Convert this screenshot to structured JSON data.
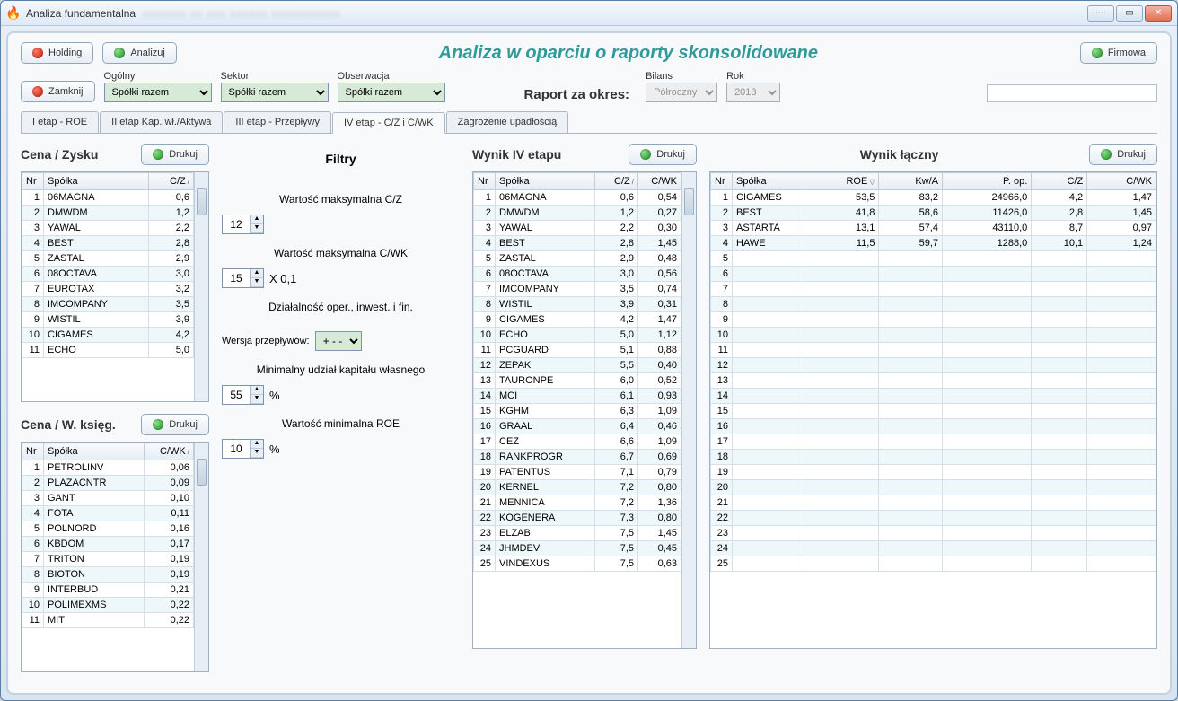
{
  "window": {
    "title": "Analiza fundamentalna"
  },
  "buttons": {
    "holding": "Holding",
    "analizuj": "Analizuj",
    "firmowa": "Firmowa",
    "zamknij": "Zamknij",
    "drukuj": "Drukuj"
  },
  "main_title": "Analiza w oparciu o raporty skonsolidowane",
  "filters_top": {
    "ogolny": {
      "label": "Ogólny",
      "value": "Spółki razem"
    },
    "sektor": {
      "label": "Sektor",
      "value": "Spółki razem"
    },
    "obserwacja": {
      "label": "Obserwacja",
      "value": "Spółki razem"
    },
    "raport_label": "Raport za okres:",
    "bilans": {
      "label": "Bilans",
      "value": "Półroczny"
    },
    "rok": {
      "label": "Rok",
      "value": "2013"
    }
  },
  "tabs": [
    "I etap - ROE",
    "II etap Kap. wł./Aktywa",
    "III etap - Przepływy",
    "IV etap - C/Z i C/WK",
    "Zagrożenie upadłością"
  ],
  "active_tab": 3,
  "section_titles": {
    "cz": "Cena / Zysku",
    "cwk": "Cena / W. księg.",
    "wynik4": "Wynik IV etapu",
    "wynikL": "Wynik łączny",
    "filtry": "Filtry"
  },
  "cols": {
    "nr": "Nr",
    "spolka": "Spółka",
    "cz": "C/Z",
    "cwk": "C/WK",
    "roe": "ROE",
    "kwa": "Kw/A",
    "pop": "P. op."
  },
  "table_cz": [
    {
      "nr": 1,
      "sp": "06MAGNA",
      "v": "0,6"
    },
    {
      "nr": 2,
      "sp": "DMWDM",
      "v": "1,2"
    },
    {
      "nr": 3,
      "sp": "YAWAL",
      "v": "2,2"
    },
    {
      "nr": 4,
      "sp": "BEST",
      "v": "2,8"
    },
    {
      "nr": 5,
      "sp": "ZASTAL",
      "v": "2,9"
    },
    {
      "nr": 6,
      "sp": "08OCTAVA",
      "v": "3,0"
    },
    {
      "nr": 7,
      "sp": "EUROTAX",
      "v": "3,2"
    },
    {
      "nr": 8,
      "sp": "IMCOMPANY",
      "v": "3,5"
    },
    {
      "nr": 9,
      "sp": "WISTIL",
      "v": "3,9"
    },
    {
      "nr": 10,
      "sp": "CIGAMES",
      "v": "4,2"
    },
    {
      "nr": 11,
      "sp": "ECHO",
      "v": "5,0"
    }
  ],
  "table_cwk": [
    {
      "nr": 1,
      "sp": "PETROLINV",
      "v": "0,06"
    },
    {
      "nr": 2,
      "sp": "PLAZACNTR",
      "v": "0,09"
    },
    {
      "nr": 3,
      "sp": "GANT",
      "v": "0,10"
    },
    {
      "nr": 4,
      "sp": "FOTA",
      "v": "0,11"
    },
    {
      "nr": 5,
      "sp": "POLNORD",
      "v": "0,16"
    },
    {
      "nr": 6,
      "sp": "KBDOM",
      "v": "0,17"
    },
    {
      "nr": 7,
      "sp": "TRITON",
      "v": "0,19"
    },
    {
      "nr": 8,
      "sp": "BIOTON",
      "v": "0,19"
    },
    {
      "nr": 9,
      "sp": "INTERBUD",
      "v": "0,21"
    },
    {
      "nr": 10,
      "sp": "POLIMEXMS",
      "v": "0,22"
    },
    {
      "nr": 11,
      "sp": "MIT",
      "v": "0,22"
    }
  ],
  "table_wynik4": [
    {
      "nr": 1,
      "sp": "06MAGNA",
      "cz": "0,6",
      "cwk": "0,54"
    },
    {
      "nr": 2,
      "sp": "DMWDM",
      "cz": "1,2",
      "cwk": "0,27"
    },
    {
      "nr": 3,
      "sp": "YAWAL",
      "cz": "2,2",
      "cwk": "0,30"
    },
    {
      "nr": 4,
      "sp": "BEST",
      "cz": "2,8",
      "cwk": "1,45"
    },
    {
      "nr": 5,
      "sp": "ZASTAL",
      "cz": "2,9",
      "cwk": "0,48"
    },
    {
      "nr": 6,
      "sp": "08OCTAVA",
      "cz": "3,0",
      "cwk": "0,56"
    },
    {
      "nr": 7,
      "sp": "IMCOMPANY",
      "cz": "3,5",
      "cwk": "0,74"
    },
    {
      "nr": 8,
      "sp": "WISTIL",
      "cz": "3,9",
      "cwk": "0,31"
    },
    {
      "nr": 9,
      "sp": "CIGAMES",
      "cz": "4,2",
      "cwk": "1,47"
    },
    {
      "nr": 10,
      "sp": "ECHO",
      "cz": "5,0",
      "cwk": "1,12"
    },
    {
      "nr": 11,
      "sp": "PCGUARD",
      "cz": "5,1",
      "cwk": "0,88"
    },
    {
      "nr": 12,
      "sp": "ZEPAK",
      "cz": "5,5",
      "cwk": "0,40"
    },
    {
      "nr": 13,
      "sp": "TAURONPE",
      "cz": "6,0",
      "cwk": "0,52"
    },
    {
      "nr": 14,
      "sp": "MCI",
      "cz": "6,1",
      "cwk": "0,93"
    },
    {
      "nr": 15,
      "sp": "KGHM",
      "cz": "6,3",
      "cwk": "1,09"
    },
    {
      "nr": 16,
      "sp": "GRAAL",
      "cz": "6,4",
      "cwk": "0,46"
    },
    {
      "nr": 17,
      "sp": "CEZ",
      "cz": "6,6",
      "cwk": "1,09"
    },
    {
      "nr": 18,
      "sp": "RANKPROGR",
      "cz": "6,7",
      "cwk": "0,69"
    },
    {
      "nr": 19,
      "sp": "PATENTUS",
      "cz": "7,1",
      "cwk": "0,79"
    },
    {
      "nr": 20,
      "sp": "KERNEL",
      "cz": "7,2",
      "cwk": "0,80"
    },
    {
      "nr": 21,
      "sp": "MENNICA",
      "cz": "7,2",
      "cwk": "1,36"
    },
    {
      "nr": 22,
      "sp": "KOGENERA",
      "cz": "7,3",
      "cwk": "0,80"
    },
    {
      "nr": 23,
      "sp": "ELZAB",
      "cz": "7,5",
      "cwk": "1,45"
    },
    {
      "nr": 24,
      "sp": "JHMDEV",
      "cz": "7,5",
      "cwk": "0,45"
    },
    {
      "nr": 25,
      "sp": "VINDEXUS",
      "cz": "7,5",
      "cwk": "0,63"
    }
  ],
  "table_wynikL": [
    {
      "nr": 1,
      "sp": "CIGAMES",
      "roe": "53,5",
      "kwa": "83,2",
      "pop": "24966,0",
      "cz": "4,2",
      "cwk": "1,47"
    },
    {
      "nr": 2,
      "sp": "BEST",
      "roe": "41,8",
      "kwa": "58,6",
      "pop": "11426,0",
      "cz": "2,8",
      "cwk": "1,45"
    },
    {
      "nr": 3,
      "sp": "ASTARTA",
      "roe": "13,1",
      "kwa": "57,4",
      "pop": "43110,0",
      "cz": "8,7",
      "cwk": "0,97"
    },
    {
      "nr": 4,
      "sp": "HAWE",
      "roe": "11,5",
      "kwa": "59,7",
      "pop": "1288,0",
      "cz": "10,1",
      "cwk": "1,24"
    }
  ],
  "empty_rows": 21,
  "filters": {
    "max_cz_label": "Wartość maksymalna C/Z",
    "max_cz": "12",
    "max_cwk_label": "Wartość maksymalna C/WK",
    "max_cwk": "15",
    "max_cwk_suffix": "X 0,1",
    "dz_label": "Działalność oper., inwest. i fin.",
    "wersja_label": "Wersja przepływów:",
    "wersja": "+ - -",
    "udz_label": "Minimalny udział kapitału własnego",
    "udz": "55",
    "pct": "%",
    "roe_label": "Wartość minimalna ROE",
    "roe": "10"
  }
}
